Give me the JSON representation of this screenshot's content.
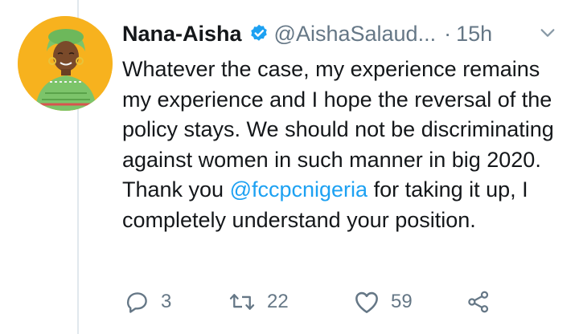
{
  "author": {
    "display_name": "Nana-Aisha",
    "handle": "@AishaSalaud...",
    "separator": "·",
    "timestamp": "15h"
  },
  "tweet": {
    "text_before_mention": "Whatever the case, my experience remains my experience and I hope the reversal of the policy stays. We should not be discriminating against women in such manner in big 2020. Thank you ",
    "mention": "@fccpcnigeria",
    "text_after_mention": " for taking it up, I completely understand your position."
  },
  "actions": {
    "reply_count": "3",
    "retweet_count": "22",
    "like_count": "59"
  },
  "icons": {
    "verified": "verified-badge-icon",
    "caret": "chevron-down-icon",
    "reply": "reply-icon",
    "retweet": "retweet-icon",
    "like": "heart-icon",
    "share": "share-icon"
  },
  "colors": {
    "accent": "#1da1f2",
    "muted": "#657786",
    "text": "#14171a",
    "avatar_bg": "#f7b21e"
  }
}
